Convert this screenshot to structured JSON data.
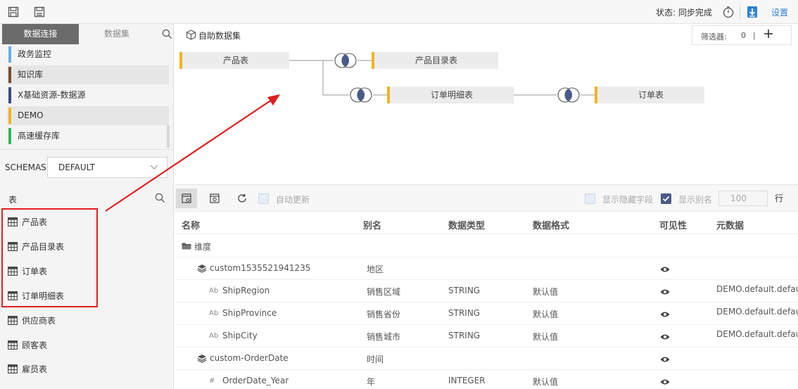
{
  "status": {
    "text": "状态: 同步完成"
  },
  "settings_label": "设置",
  "tabs": {
    "active": "数据连接",
    "inactive": "数据集"
  },
  "datasources": [
    {
      "label": "政务监控",
      "color": "#66aee8"
    },
    {
      "label": "知识库",
      "color": "#7a4a2a"
    },
    {
      "label": "X基础资源-数据源",
      "color": "#3a4a8a"
    },
    {
      "label": "DEMO",
      "color": "#f2b322"
    },
    {
      "label": "高速缓存库",
      "color": "#2fb85a"
    }
  ],
  "schemas": {
    "label": "SCHEMAS",
    "value": "DEFAULT"
  },
  "tables_label": "表",
  "tables": [
    "产品表",
    "产品目录表",
    "订单表",
    "订单明细表",
    "供应商表",
    "顾客表",
    "雇员表"
  ],
  "canvas": {
    "title": "自助数据集",
    "filter_label": "筛选器:",
    "filter_count": "0",
    "filter_sep": "|",
    "nodes": {
      "product": "产品表",
      "category": "产品目录表",
      "order_detail": "订单明细表",
      "order": "订单表"
    }
  },
  "grid": {
    "auto_update": "自动更新",
    "show_hidden": "显示隐藏字段",
    "show_alias": "显示别名",
    "rows_value": "100",
    "rows_label": "行",
    "headers": [
      "名称",
      "别名",
      "数据类型",
      "数据格式",
      "可见性",
      "元数据"
    ],
    "rows": [
      {
        "kind": "folder",
        "name": "维度",
        "alias": "",
        "type": "",
        "format": "",
        "visible": false,
        "meta": ""
      },
      {
        "kind": "group",
        "name": "custom1535521941235",
        "alias": "地区",
        "type": "",
        "format": "",
        "visible": true,
        "meta": ""
      },
      {
        "kind": "text",
        "name": "ShipRegion",
        "alias": "销售区域",
        "type": "STRING",
        "format": "默认值",
        "visible": true,
        "meta": "DEMO.default.defau"
      },
      {
        "kind": "text",
        "name": "ShipProvince",
        "alias": "销售省份",
        "type": "STRING",
        "format": "默认值",
        "visible": true,
        "meta": "DEMO.default.defau"
      },
      {
        "kind": "text",
        "name": "ShipCity",
        "alias": "销售城市",
        "type": "STRING",
        "format": "默认值",
        "visible": true,
        "meta": "DEMO.default.defau"
      },
      {
        "kind": "group",
        "name": "custom-OrderDate",
        "alias": "时间",
        "type": "",
        "format": "",
        "visible": true,
        "meta": ""
      },
      {
        "kind": "num",
        "name": "OrderDate_Year",
        "alias": "年",
        "type": "INTEGER",
        "format": "默认值",
        "visible": true,
        "meta": ""
      }
    ]
  },
  "colors": {
    "accent": "#2f7fd6",
    "node_bar": "#f2b322",
    "highlight": "#e02020",
    "join_fill": "#4a5a8a"
  }
}
